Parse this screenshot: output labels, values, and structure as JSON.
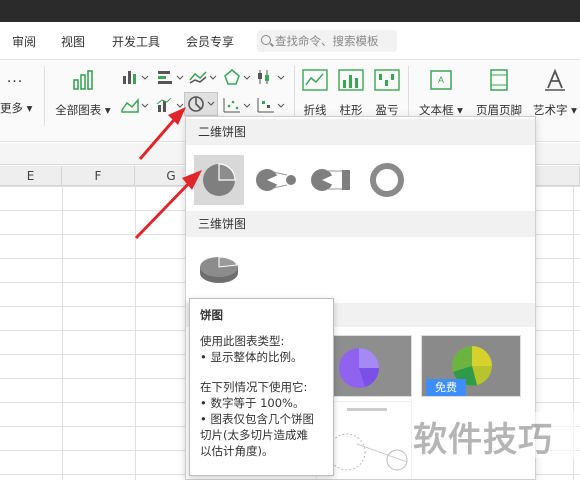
{
  "menu": {
    "tabs": [
      "审阅",
      "视图",
      "开发工具",
      "会员专享"
    ],
    "search_placeholder": "查找命令、搜索模板"
  },
  "ribbon": {
    "more_label": "更多",
    "all_charts_label": "全部图表",
    "line_label": "折线",
    "column_label": "柱形",
    "winloss_label": "盈亏",
    "textbox_label": "文本框",
    "header_footer_label": "页眉页脚",
    "wordart_label": "艺术字"
  },
  "sheet": {
    "columns": [
      "E",
      "F",
      "G"
    ]
  },
  "dropdown": {
    "section_2d": "二维饼图",
    "section_3d": "三维饼图",
    "badge_free": "免费"
  },
  "tooltip": {
    "title": "饼图",
    "line1": "使用此图表类型:",
    "line2": "• 显示整体的比例。",
    "line3": "在下列情况下使用它:",
    "line4": "• 数字等于 100%。",
    "line5": "• 图表仅包含几个饼图",
    "line6": "切片(太多切片造成难",
    "line7": "以估计角度)。"
  },
  "watermark": "软件技巧",
  "colors": {
    "accent_green": "#3aa655",
    "badge_blue": "#3f8ef7",
    "arrow_red": "#e0262a",
    "chart_gray": "#7f7f7f"
  }
}
